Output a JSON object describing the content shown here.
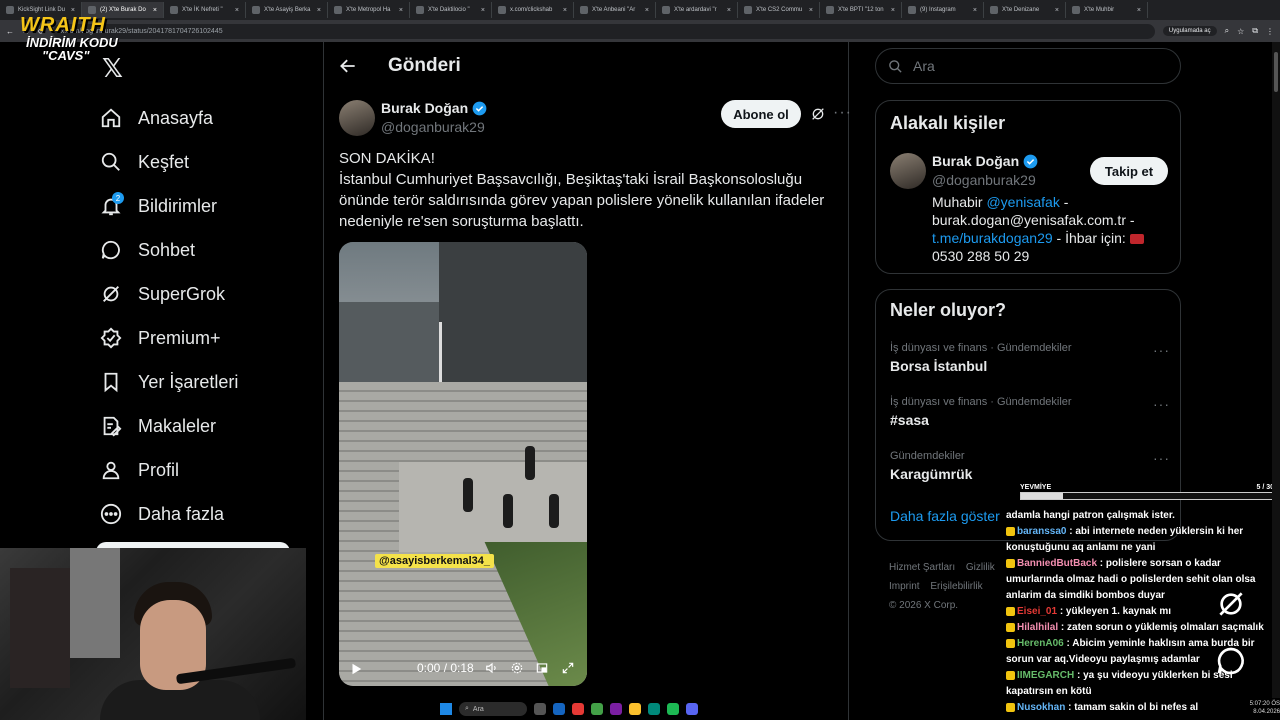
{
  "browser": {
    "tabs": [
      {
        "label": "KickSight Link Du",
        "active": false
      },
      {
        "label": "(2) X'te Burak Do",
        "active": true
      },
      {
        "label": "X'te İK Nefreti \"",
        "active": false
      },
      {
        "label": "X'te Asayiş Berka",
        "active": false
      },
      {
        "label": "X'te Metropol Ha",
        "active": false
      },
      {
        "label": "X'te Daktilocio \"",
        "active": false
      },
      {
        "label": "x.com/clickshab",
        "active": false
      },
      {
        "label": "X'te Anbeani \"Ar",
        "active": false
      },
      {
        "label": "X'te ardardavi \"r",
        "active": false
      },
      {
        "label": "X'te CS2 Commu",
        "active": false
      },
      {
        "label": "X'te BPTI \"12 ton",
        "active": false
      },
      {
        "label": "(9) Instagram",
        "active": false
      },
      {
        "label": "X'te Denizane",
        "active": false
      },
      {
        "label": "X'te Muhbir",
        "active": false
      }
    ],
    "url": "x.com/doganburak29/status/2041781704726102445",
    "open_in_app": "Uygulamada aç"
  },
  "overlay": {
    "brand": "WRAITH",
    "code_label": "İNDİRİM KODU",
    "code": "\"CAVS\""
  },
  "nav": {
    "items": [
      {
        "label": "Anasayfa",
        "icon": "home-icon"
      },
      {
        "label": "Keşfet",
        "icon": "search-icon"
      },
      {
        "label": "Bildirimler",
        "icon": "bell-icon",
        "badge": "2"
      },
      {
        "label": "Sohbet",
        "icon": "chat-icon"
      },
      {
        "label": "SuperGrok",
        "icon": "grok-icon"
      },
      {
        "label": "Premium+",
        "icon": "premium-icon"
      },
      {
        "label": "Yer İşaretleri",
        "icon": "bookmark-icon"
      },
      {
        "label": "Makaleler",
        "icon": "article-icon"
      },
      {
        "label": "Profil",
        "icon": "profile-icon"
      },
      {
        "label": "Daha fazla",
        "icon": "more-circle-icon"
      }
    ]
  },
  "post": {
    "header": "Gönderi",
    "author_name": "Burak Doğan",
    "author_handle": "@doganburak29",
    "subscribe_label": "Abone ol",
    "text_line1": "SON DAKİKA!",
    "text_body": "İstanbul Cumhuriyet Başsavcılığı, Beşiktaş'taki İsrail Başkonsolosluğu önünde terör saldırısında görev yapan polislere yönelik kullanılan ifadeler nedeniyle re'sen soruşturma başlattı.",
    "video_watermark": "@asayisberkemal34_",
    "video_time": "0:00 / 0:18",
    "video_progress": 0
  },
  "search": {
    "placeholder": "Ara"
  },
  "related": {
    "title": "Alakalı kişiler",
    "name": "Burak Doğan",
    "handle": "@doganburak29",
    "follow_label": "Takip et",
    "bio_prefix": "Muhabir ",
    "bio_link1": "@yenisafak",
    "bio_mid": " - burak.dogan@yenisafak.com.tr - ",
    "bio_link2": "t.me/burakdogan29",
    "bio_suffix": " - İhbar için: ",
    "bio_phone": "0530 288 50 29"
  },
  "trends": {
    "title": "Neler oluyor?",
    "items": [
      {
        "meta": "İş dünyası ve finans · Gündemdekiler",
        "name": "Borsa İstanbul"
      },
      {
        "meta": "İş dünyası ve finans · Gündemdekiler",
        "name": "#sasa"
      },
      {
        "meta": "Gündemdekiler",
        "name": "Karagümrük"
      }
    ],
    "show_more": "Daha fazla göster"
  },
  "footer": {
    "links": [
      "Hizmet Şartları",
      "Gizlilik",
      "Imprint",
      "Erişilebilirlik"
    ],
    "copyright": "© 2026 X Corp."
  },
  "chat": {
    "goal_label": "YEVMİYE",
    "goal_count": "5 / 30",
    "goal_fraction": 0.167,
    "messages": [
      {
        "user": "",
        "text": "adamla hangi patron çalışmak ister.",
        "user_class": ""
      },
      {
        "user": "baranssa0",
        "text": " : abi internete neden yüklersin ki her konuştuğunu aq anlamı ne yani",
        "user_class": "u-blue"
      },
      {
        "user": "BanniedButBack",
        "text": " : polislere sorsan o kadar umurlarında olmaz hadi o polislerden sehit olan olsa anlarim da simdiki bombos duyar",
        "user_class": "u-pink"
      },
      {
        "user": "Eisei_01",
        "text": " : yükleyen 1. kaynak mı",
        "user_class": "u-red"
      },
      {
        "user": "Hilalhilal",
        "text": " : zaten sorun o yüklemiş olmaları saçmalık",
        "user_class": "u-pink"
      },
      {
        "user": "HerenA06",
        "text": " : Abicim yeminle haklısın ama burda bir sorun var aq.Videoyu paylaşmış adamlar",
        "user_class": "u-green"
      },
      {
        "user": "IIMEGARCH",
        "text": " : ya şu videoyu yüklerken bi sesi kapatırsın en kötü",
        "user_class": "u-green"
      },
      {
        "user": "Nusokhan",
        "text": " : tamam sakin ol bi nefes al",
        "user_class": "u-blue"
      }
    ]
  },
  "taskbar": {
    "search_label": "Ara",
    "time": "5:07:20 ÖS",
    "date": "8.04.2026"
  },
  "colors": {
    "accent": "#1d9bf0",
    "background": "#000000",
    "border": "#2f3336",
    "muted": "#71767b"
  }
}
